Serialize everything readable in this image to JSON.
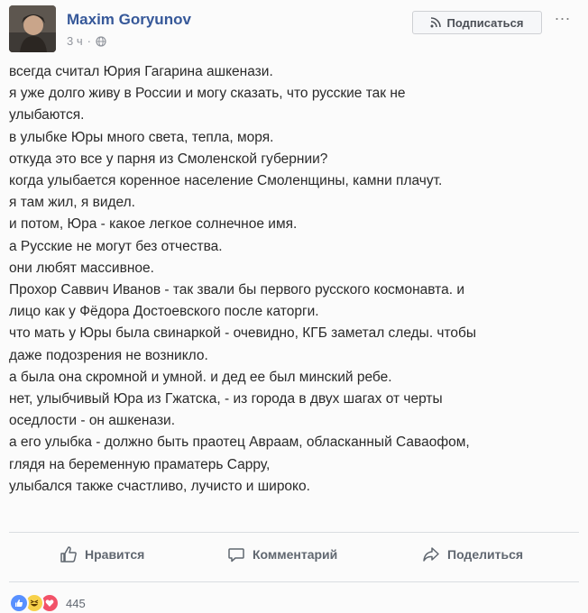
{
  "post": {
    "author": "Maxim Goryunov",
    "time": "3 ч",
    "privacy_icon": "globe-icon",
    "subscribe_label": "Подписаться",
    "more_label": "...",
    "lines": [
      "всегда считал Юрия Гагарина ашкенази.",
      "я уже долго живу в России и могу сказать, что русские так не",
      "улыбаются.",
      "в улыбке Юры много света, тепла, моря.",
      "откуда это все у парня из Смоленской губернии?",
      "когда улыбается коренное население Смоленщины, камни плачут.",
      "я там жил, я видел.",
      "и потом, Юра - какое легкое солнечное имя.",
      "а Русские не могут без отчества.",
      "они любят массивное.",
      "Прохор Саввич Иванов - так звали бы первого русского космонавта. и",
      "лицо как у Фёдора Достоевского после каторги.",
      "что мать у Юры была свинаркой - очевидно, КГБ заметал следы. чтобы",
      "даже подозрения не возникло.",
      "а была она скромной и умной. и дед ее был минский ребе.",
      "нет, улыбчивый Юра из Гжатска, - из города в двух шагах от черты",
      "оседлости - он ашкенази.",
      "а его улыбка - должно быть праотец Авраам, обласканный Саваофом,",
      "глядя на беременную праматерь Сарру,",
      "улыбался также счастливо, лучисто и широко."
    ]
  },
  "actions": {
    "like": "Нравится",
    "comment": "Комментарий",
    "share": "Поделиться"
  },
  "reactions": {
    "types": [
      "like",
      "haha",
      "love"
    ],
    "count": "445"
  },
  "colors": {
    "link": "#365899",
    "like_blue": "#5890ff",
    "haha_yellow": "#f7d14a",
    "love_red": "#f25268"
  }
}
